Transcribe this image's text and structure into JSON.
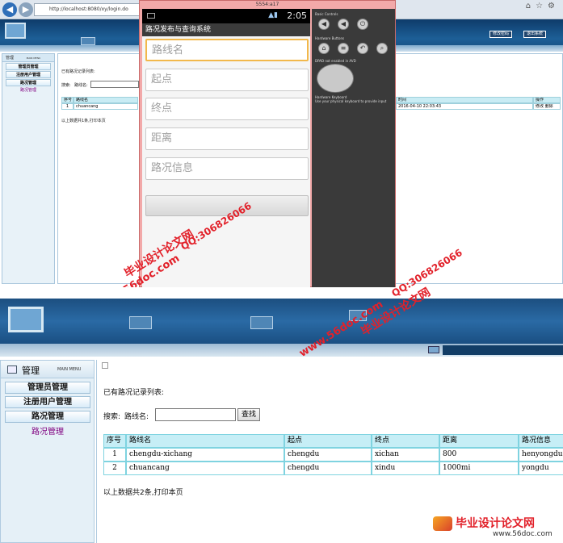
{
  "top": {
    "browser": {
      "url": "http://localhost:8080/xy/login.do"
    },
    "header_buttons": [
      "修改密码",
      "退出系统"
    ],
    "left_panel": {
      "title": "管理",
      "title_en": "MAIN MENU",
      "items": [
        "管理员管理",
        "注册用户管理",
        "路况管理"
      ],
      "sub_item": "路况管理"
    },
    "content": {
      "list_title": "已有路况记录列表:",
      "search_label": "搜索:",
      "field_label": "路线名:",
      "columns": [
        "序号",
        "路线名",
        "时间",
        "操作"
      ],
      "row": {
        "index": "1",
        "name": "chuancang",
        "time": "2016-04-10 22:03:43",
        "actions": "修改 删除"
      },
      "footer": "以上数据共1条,打印本页"
    },
    "emulator": {
      "title": "5554:a17",
      "clock": "2:05",
      "app_title": "路况发布与查询系统",
      "fields": [
        "路线名",
        "起点",
        "终点",
        "距离",
        "路况信息"
      ],
      "controls": {
        "basic": "Basic Controls",
        "hardware": "Hardware Buttons",
        "dpad": "DPAD not enabled in AVD",
        "keyboard": "Hardware Keyboard",
        "keyboard_sub": "Use your physical keyboard to provide input"
      }
    }
  },
  "bottom": {
    "left_panel": {
      "title": "管理",
      "title_en": "MAIN MENU",
      "items": [
        "管理员管理",
        "注册用户管理",
        "路况管理"
      ],
      "sub_item": "路况管理"
    },
    "content": {
      "list_title": "已有路况记录列表:",
      "search_label": "搜索:",
      "field_label": "路线名:",
      "search_button": "查找",
      "columns": [
        "序号",
        "路线名",
        "起点",
        "终点",
        "距离",
        "路况信息"
      ],
      "rows": [
        [
          "1",
          "chengdu-xichang",
          "chengdu",
          "xichan",
          "800",
          "henyongdu"
        ],
        [
          "2",
          "chuancang",
          "chengdu",
          "xindu",
          "1000mi",
          "yongdu"
        ]
      ],
      "footer": "以上数据共2条,打印本页"
    }
  },
  "watermarks": {
    "site": "www.56doc.com",
    "qq": "QQ:306826066",
    "brand": "毕业设计论文网",
    "footer_site": "www.56doc.com"
  },
  "colors": {
    "watermark": "#e2212a",
    "header": "#1d5f97",
    "table_header": "#c6eef6"
  }
}
